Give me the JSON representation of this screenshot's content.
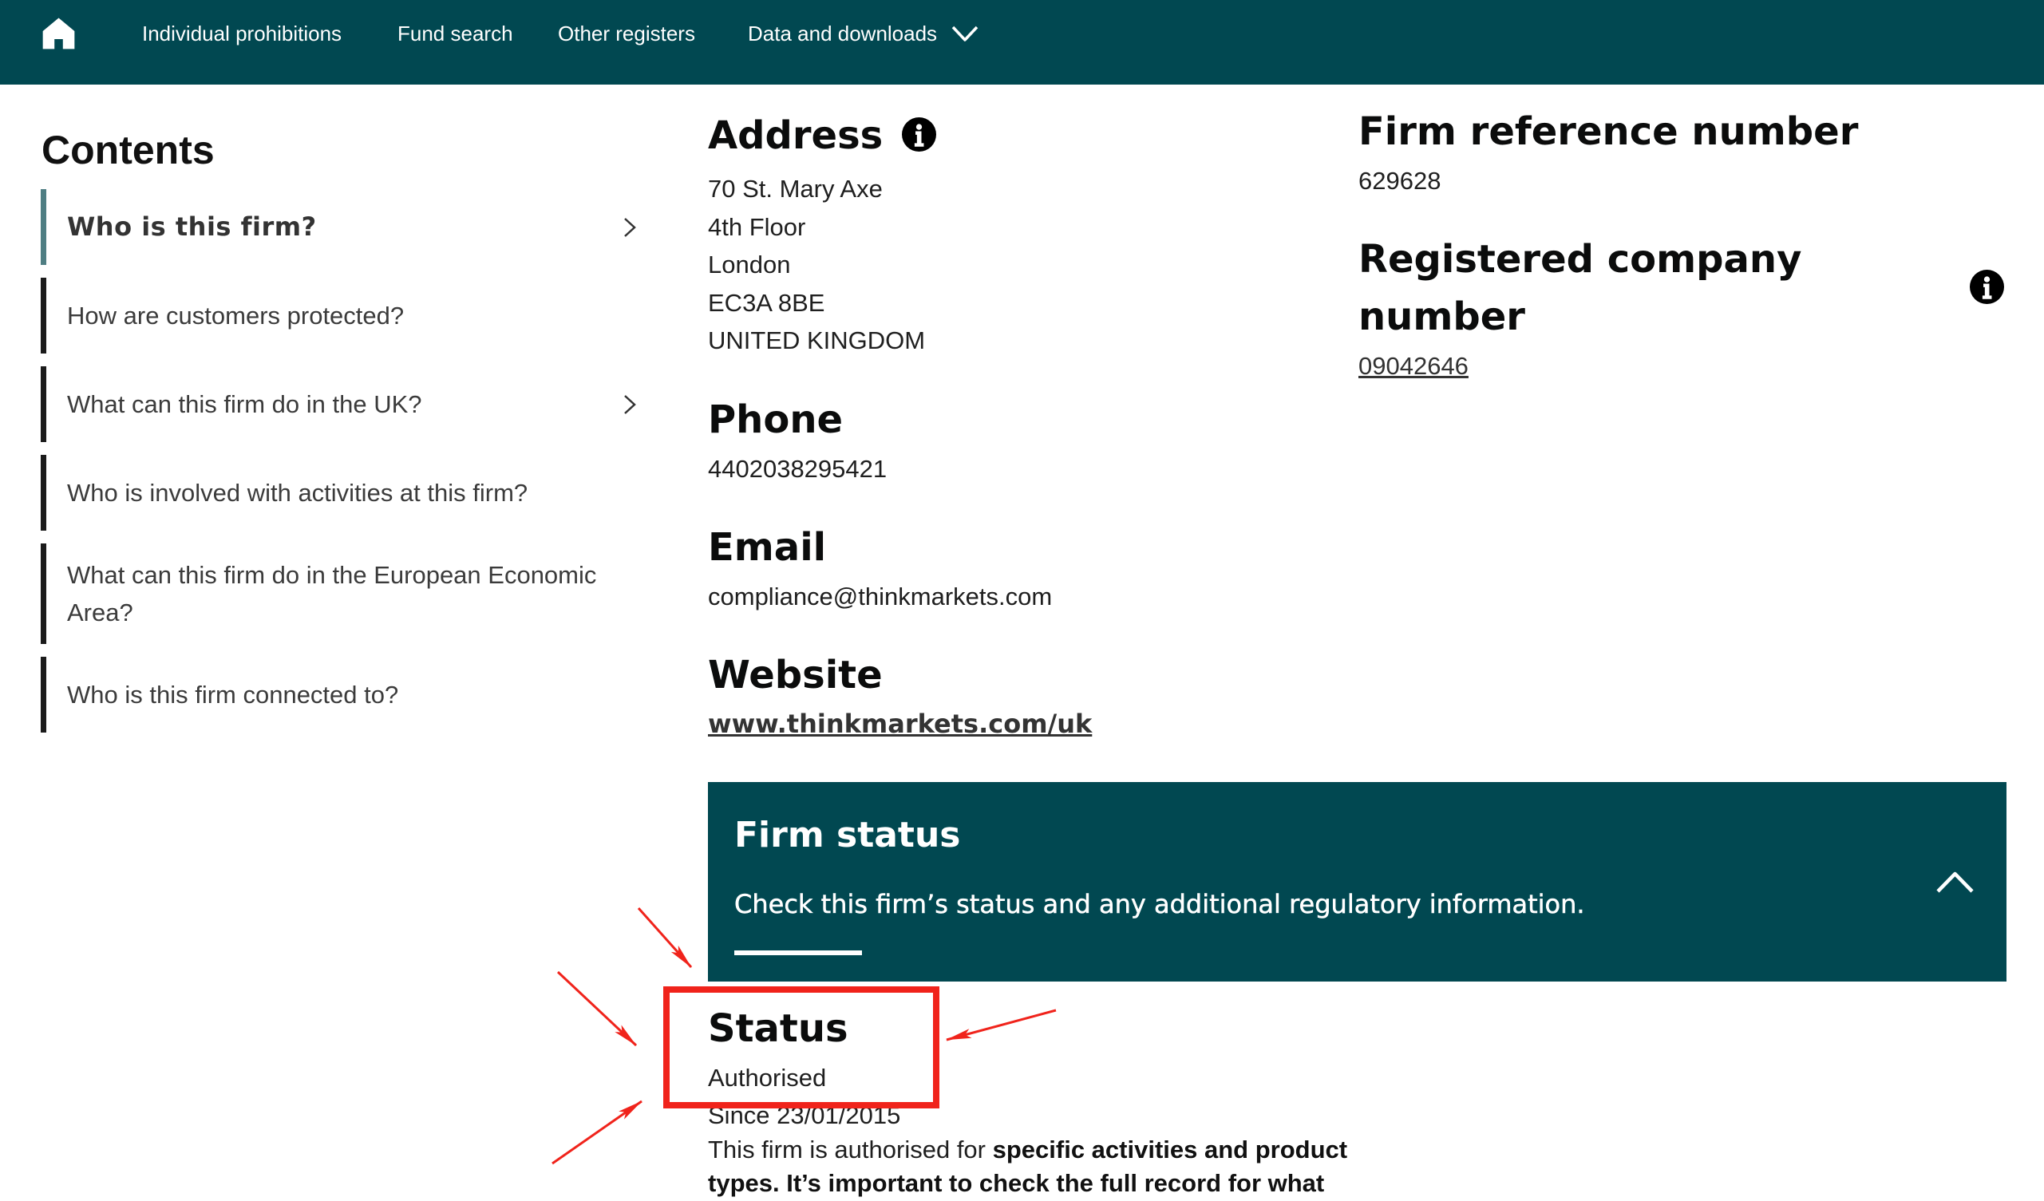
{
  "colors": {
    "brand": "#014851",
    "active_indicator": "#4f7e83",
    "annotation": "#f0231b"
  },
  "nav": {
    "icons": {
      "home": "home-icon",
      "dropdown": "chevron-down-icon"
    },
    "items": [
      {
        "label": "Individual prohibitions"
      },
      {
        "label": "Fund search"
      },
      {
        "label": "Other registers"
      },
      {
        "label": "Data and downloads"
      }
    ]
  },
  "sidebar": {
    "title": "Contents",
    "items": [
      {
        "label": "Who is this firm?",
        "active": true,
        "icon": "chevron-right-icon"
      },
      {
        "label": "How are customers protected?"
      },
      {
        "label": "What can this firm do in the UK?",
        "icon": "chevron-right-icon"
      },
      {
        "label": "Who is involved with activities at this firm?"
      },
      {
        "label": "What can this firm do in the European Economic Area?"
      },
      {
        "label": "Who is this firm connected to?"
      }
    ]
  },
  "address": {
    "heading": "Address",
    "icon": "info-icon",
    "lines": [
      "70 St. Mary Axe",
      "4th Floor",
      "London",
      "EC3A 8BE",
      "UNITED KINGDOM"
    ]
  },
  "phone": {
    "heading": "Phone",
    "value": "4402038295421"
  },
  "email": {
    "heading": "Email",
    "value": "compliance@thinkmarkets.com"
  },
  "website": {
    "heading": "Website",
    "value": "www.thinkmarkets.com/uk"
  },
  "firm_reference": {
    "heading": "Firm reference number",
    "value": "629628"
  },
  "company_number": {
    "heading": "Registered company number",
    "value": "09042646",
    "icon": "info-icon"
  },
  "firm_status": {
    "title": "Firm status",
    "description": "Check this firm’s status and any additional regulatory information.",
    "expanded": true,
    "icon": "chevron-up-icon"
  },
  "status": {
    "heading": "Status",
    "value": "Authorised",
    "since": "Since 23/01/2015",
    "description_prefix": "This firm is authorised for ",
    "description_bold": "specific activities and product types. It’s important to check the full record for what"
  }
}
